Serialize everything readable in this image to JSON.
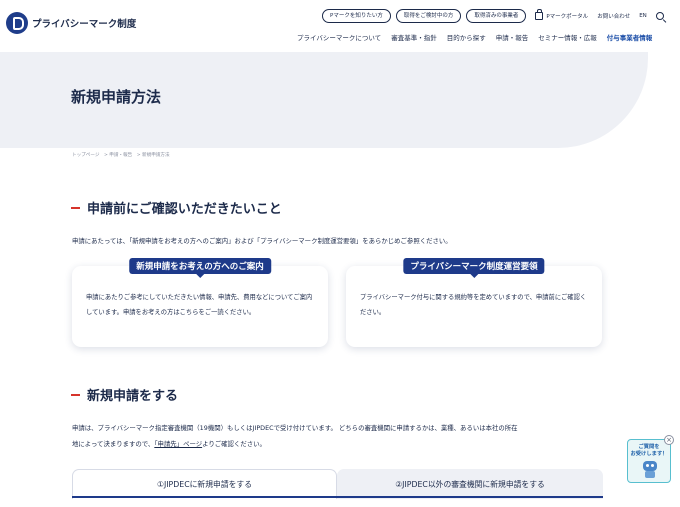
{
  "header": {
    "logo_text": "プライバシーマーク制度",
    "utility": {
      "pills": [
        "Pマークを知りたい方",
        "取得をご検討中の方",
        "取得済みの事業者"
      ],
      "portal": "Pマークポータル",
      "contact": "お問い合わせ",
      "lang": "EN"
    },
    "nav": [
      "プライバシーマークについて",
      "審査基準・指針",
      "目的から探す",
      "申請・報告",
      "セミナー情報・広報",
      "付与事業者情報"
    ]
  },
  "hero": {
    "title": "新規申請方法"
  },
  "breadcrumb": [
    "トップページ",
    "> 申請・報告",
    "> 新規申請方法"
  ],
  "section1": {
    "heading": "申請前にご確認いただきたいこと",
    "intro": "申請にあたっては、「新規申請をお考えの方へのご案内」および「プライバシーマーク制度運営要領」をあらかじめご参照ください。",
    "cards": [
      {
        "tag": "新規申請をお考えの方へのご案内",
        "body": "申請にあたりご参考にしていただきたい情報、申請先、費用などについてご案内しています。申請をお考えの方はこちらをご一読ください。"
      },
      {
        "tag": "プライバシーマーク制度運営要領",
        "body": "プライバシーマーク付与に関する規約等を定めていますので、申請前にご確認ください。"
      }
    ]
  },
  "section2": {
    "heading": "新規申請をする",
    "line1": "申請は、プライバシーマーク指定審査機関（19機関）もしくはJIPDECで受け付けています。 どちらの審査機関に申請するかは、業種、あるいは本社の所在",
    "line2_pre": "地によって決まりますので、",
    "line2_link": "「申請先」ページ",
    "line2_post": "よりご確認ください。",
    "tabs": [
      "①JIPDECに新規申請をする",
      "②JIPDEC以外の審査機関に新規申請をする"
    ]
  },
  "widget": {
    "text": "ご質問を\nお受けします！",
    "close": "×"
  },
  "colors": {
    "brand_navy": "#1e3a8a",
    "accent_red": "#d6342b",
    "hero_bg": "#eef0f5",
    "widget_border": "#58bfcf"
  }
}
